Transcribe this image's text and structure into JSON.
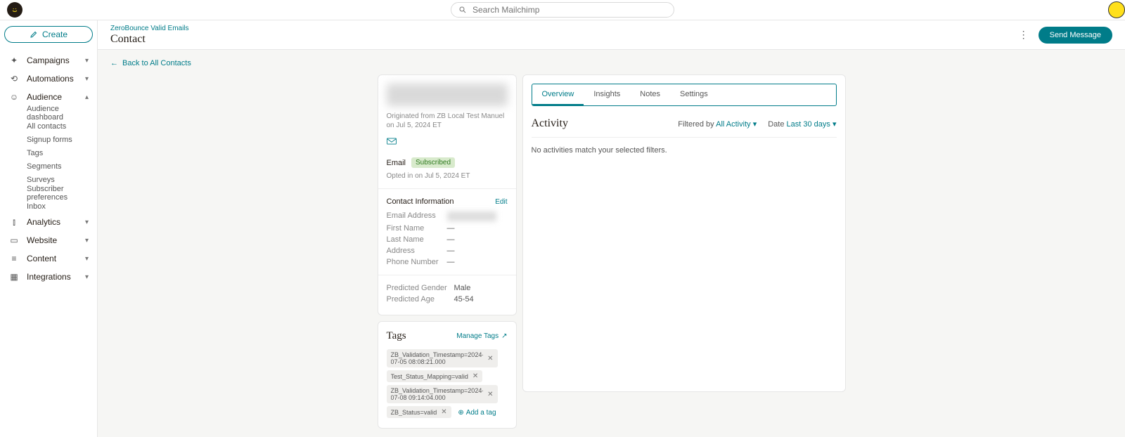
{
  "search": {
    "placeholder": "Search Mailchimp"
  },
  "sidebar": {
    "create": "Create",
    "items": [
      {
        "label": "Campaigns",
        "chev": "▾"
      },
      {
        "label": "Automations",
        "chev": "▾"
      },
      {
        "label": "Audience",
        "chev": "▴"
      }
    ],
    "audienceSub": [
      "Audience dashboard",
      "All contacts",
      "Signup forms",
      "Tags",
      "Segments",
      "Surveys",
      "Subscriber preferences",
      "Inbox"
    ],
    "items2": [
      {
        "label": "Analytics",
        "chev": "▾"
      },
      {
        "label": "Website",
        "chev": "▾"
      },
      {
        "label": "Content",
        "chev": "▾"
      },
      {
        "label": "Integrations",
        "chev": "▾"
      }
    ]
  },
  "header": {
    "breadcrumb": "ZeroBounce Valid Emails",
    "title": "Contact",
    "send": "Send Message"
  },
  "back": "Back to All Contacts",
  "profile": {
    "origin": "Originated from ZB Local Test Manuel on Jul 5, 2024 ET",
    "emailLabel": "Email",
    "subscribed": "Subscribed",
    "optin": "Opted in on Jul 5, 2024 ET",
    "contactInfo": "Contact Information",
    "edit": "Edit",
    "rows": [
      {
        "k": "Email Address",
        "v": ""
      },
      {
        "k": "First Name",
        "v": "—"
      },
      {
        "k": "Last Name",
        "v": "—"
      },
      {
        "k": "Address",
        "v": "—"
      },
      {
        "k": "Phone Number",
        "v": "—"
      }
    ],
    "pred": [
      {
        "k": "Predicted Gender",
        "v": "Male"
      },
      {
        "k": "Predicted Age",
        "v": "45-54"
      }
    ]
  },
  "tags": {
    "title": "Tags",
    "manage": "Manage Tags",
    "list": [
      "ZB_Validation_Timestamp=2024-07-05 08:08:21.000",
      "Test_Status_Mapping=valid",
      "ZB_Validation_Timestamp=2024-07-08 09:14:04.000",
      "ZB_Status=valid"
    ],
    "add": "Add a tag"
  },
  "tabs": [
    "Overview",
    "Insights",
    "Notes",
    "Settings"
  ],
  "activity": {
    "title": "Activity",
    "f1l": "Filtered by",
    "f1v": "All Activity",
    "f2l": "Date",
    "f2v": "Last 30 days",
    "empty": "No activities match your selected filters."
  }
}
